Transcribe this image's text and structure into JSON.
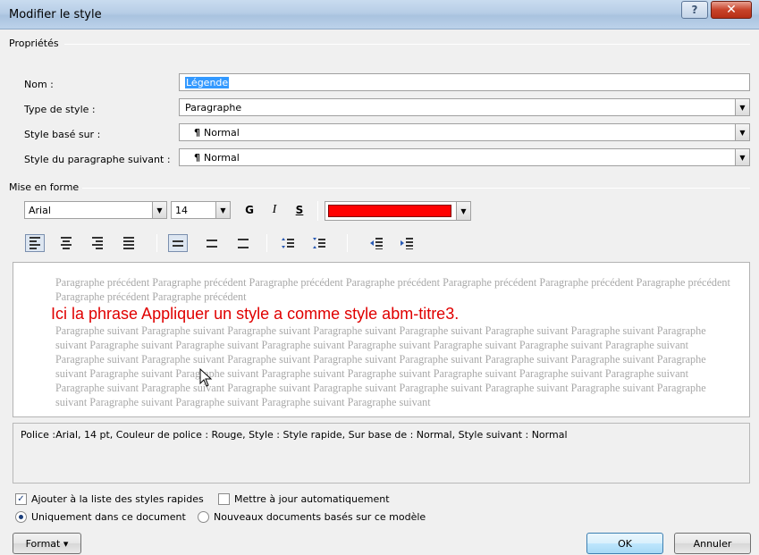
{
  "window": {
    "title": "Modifier le style",
    "help_icon": "?",
    "close_icon": "✕"
  },
  "properties": {
    "section_label": "Propriétés",
    "name": {
      "label": "Nom :",
      "value": "Légende"
    },
    "style_type": {
      "label": "Type de style :",
      "value": "Paragraphe"
    },
    "based_on": {
      "label": "Style basé sur :",
      "value": "Normal"
    },
    "next_style": {
      "label": "Style du paragraphe suivant :",
      "value": "Normal"
    },
    "paragraph_mark": "¶"
  },
  "formatting": {
    "section_label": "Mise en forme",
    "font": "Arial",
    "size": "14",
    "bold": "G",
    "italic": "I",
    "underline": "S",
    "color": "#ff0000"
  },
  "preview": {
    "previous_text": "Paragraphe précédent Paragraphe précédent Paragraphe précédent Paragraphe précédent Paragraphe précédent Paragraphe précédent Paragraphe précédent Paragraphe précédent Paragraphe précédent",
    "sample_text": "Ici la phrase Appliquer un style a comme style abm-titre3.",
    "following_text": "Paragraphe suivant Paragraphe suivant Paragraphe suivant Paragraphe suivant Paragraphe suivant Paragraphe suivant Paragraphe suivant Paragraphe suivant Paragraphe suivant Paragraphe suivant Paragraphe suivant Paragraphe suivant Paragraphe suivant Paragraphe suivant Paragraphe suivant Paragraphe suivant Paragraphe suivant Paragraphe suivant Paragraphe suivant Paragraphe suivant Paragraphe suivant Paragraphe suivant Paragraphe suivant Paragraphe suivant Paragraphe suivant Paragraphe suivant Paragraphe suivant Paragraphe suivant Paragraphe suivant Paragraphe suivant Paragraphe suivant Paragraphe suivant Paragraphe suivant Paragraphe suivant Paragraphe suivant Paragraphe suivant Paragraphe suivant Paragraphe suivant Paragraphe suivant Paragraphe suivant Paragraphe suivant Paragraphe suivant"
  },
  "description": "Police :Arial, 14 pt, Couleur de police : Rouge, Style : Style rapide, Sur base de : Normal, Style suivant : Normal",
  "options": {
    "add_quick_styles": {
      "label": "Ajouter à la liste des styles rapides",
      "checked": true
    },
    "auto_update": {
      "label": "Mettre à jour automatiquement",
      "checked": false
    },
    "this_document": {
      "label": "Uniquement dans ce document",
      "selected": true
    },
    "new_documents": {
      "label": "Nouveaux documents basés sur ce modèle",
      "selected": false
    }
  },
  "buttons": {
    "format": "Format",
    "format_arrow": "▾",
    "ok": "OK",
    "cancel": "Annuler"
  },
  "dropdown_arrow": "▼"
}
